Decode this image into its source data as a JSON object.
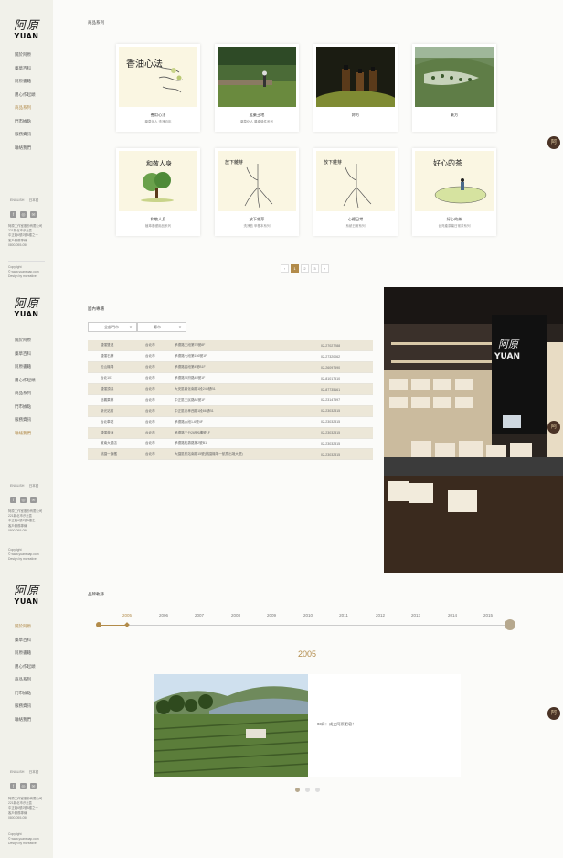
{
  "logo": {
    "cn": "阿原",
    "en": "YUAN"
  },
  "nav": [
    {
      "label": "關於阿原"
    },
    {
      "label": "藥草百科"
    },
    {
      "label": "阿原書籍"
    },
    {
      "label": "用心作起頭"
    },
    {
      "label": "商品系列"
    },
    {
      "label": "門市據點"
    },
    {
      "label": "服務資訊"
    },
    {
      "label": "聯絡我們"
    }
  ],
  "lang": "ENGLISH ｜ 日本語",
  "company_info": [
    "阿原工作室股份有限公司",
    "221新北市汐止區",
    "中正路6號2號5樓之一",
    "客戶服務專線",
    "0800-055-050"
  ],
  "copyright": [
    "Copyright",
    "© www.yuansoap.com",
    "Design by mcreative"
  ],
  "products": {
    "title": "商品系列",
    "items": [
      {
        "name": "善用心法",
        "sub": "藥草化人 洗淨百年"
      },
      {
        "name": "藍藥土地",
        "sub": "藥草化人 農產條件系列"
      },
      {
        "name": "妳方",
        "sub": ""
      },
      {
        "name": "藥方",
        "sub": ""
      },
      {
        "name": "和敬人身",
        "sub": "植萃基礎用品系列"
      },
      {
        "name": "放下雜芽",
        "sub": "洗淨苔 甲基本系列"
      },
      {
        "name": "心裡日常",
        "sub": "系統日常系列"
      },
      {
        "name": "好心的茶",
        "sub": "台灣產茶葉日常茶系列"
      }
    ],
    "art": {
      "card1": "香油心法",
      "card5": "和敬人身",
      "card6": "放下雜芽",
      "card7": "放下雜芽",
      "card8": "好心的茶"
    },
    "pages": [
      "‹",
      "1",
      "2",
      "3",
      "›"
    ],
    "active_page": "1"
  },
  "stores": {
    "title": "國內專櫃",
    "filter_region": "全部門市",
    "filter_city": "縣市",
    "rows": [
      [
        "捷運雙連",
        "台北市",
        "承德路三段第75號8F",
        "02-27027288"
      ],
      [
        "捷運石牌",
        "台北市",
        "承德路七段第156號1F",
        "02-27320062"
      ],
      [
        "松山機場",
        "台北市",
        "承德路四段第4號B1F",
        "02-26097590"
      ],
      [
        "台北101",
        "台北市",
        "承德路市府路45號1F",
        "02-81017510"
      ],
      [
        "捷運頂溪",
        "台北市",
        "大安區敦化南路1段245號B1",
        "02-87735161"
      ],
      [
        "信義果林",
        "台北市",
        "中正區三民路84號1F",
        "02-23147597"
      ],
      [
        "新光站前",
        "台北市",
        "中正區忠孝西路1段66號B1",
        "02-23032815"
      ],
      [
        "台北車站",
        "台北市",
        "承德路六段1-6號4F",
        "02-23032815"
      ],
      [
        "捷運蘆洲",
        "台北市",
        "承德路三分26號6樓號1F",
        "02-23032815"
      ],
      [
        "敦南大廣店",
        "台北市",
        "承德路松壽路第2號B1",
        "02-23032815"
      ],
      [
        "桃園一旗艦",
        "台北市",
        "大園區航站南路15號(桃園機場一航廈出境大廳)",
        "02-23032815"
      ]
    ],
    "photo_sign": {
      "cn": "阿原",
      "en": "YUAN"
    }
  },
  "brand": {
    "title": "品牌軌跡",
    "years": [
      "2005",
      "2006",
      "2007",
      "2008",
      "2009",
      "2010",
      "2011",
      "2012",
      "2013",
      "2014",
      "2015"
    ],
    "active_year": "2005",
    "event": "03月：成立阿原肥皂！"
  },
  "float_button": "阿",
  "colors": {
    "accent": "#b28b4a",
    "sidebar": "#f1f1ea",
    "table_stripe": "#ece7d8"
  }
}
